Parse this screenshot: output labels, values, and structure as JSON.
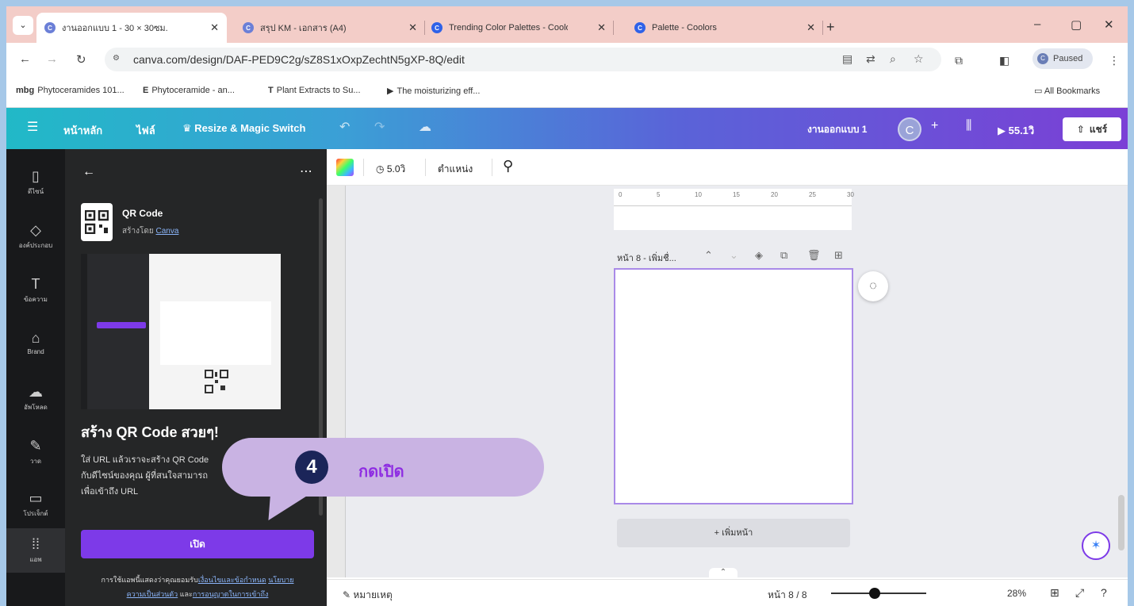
{
  "browser": {
    "tabs": [
      {
        "title": "งานออกแบบ 1 - 30 × 30ซม.",
        "fav_color": "#6b7fd7",
        "fav_glyph": "C",
        "active": true
      },
      {
        "title": "สรุป KM - เอกสาร (A4)",
        "fav_color": "#6b7fd7",
        "fav_glyph": "C",
        "active": false
      },
      {
        "title": "Trending Color Palettes - Coolo",
        "fav_color": "#2f62e8",
        "fav_glyph": "C",
        "active": false
      },
      {
        "title": "Palette - Coolors",
        "fav_color": "#2f62e8",
        "fav_glyph": "C",
        "active": false
      }
    ],
    "url": "canva.com/design/DAF-PED9C2g/sZ8S1xOxpZechtN5gXP-8Q/edit",
    "profile_status": "Paused",
    "profile_initial": "C",
    "bookmarks": [
      "Phytoceramides 101...",
      "Phytoceramide - an...",
      "Plant Extracts to Su...",
      "The moisturizing eff..."
    ],
    "bookmark_prefixes": [
      "mbg",
      "E",
      "T",
      "▶"
    ],
    "all_bookmarks": "All Bookmarks"
  },
  "canva_header": {
    "home": "หน้าหลัก",
    "file": "ไฟล์",
    "resize": "Resize & Magic Switch",
    "doc_title": "งานออกแบบ 1",
    "user_initial": "C",
    "timer": "55.1วิ",
    "share": "แชร์"
  },
  "rail": [
    {
      "label": "ดีไซน์",
      "icon": "▯"
    },
    {
      "label": "องค์ประกอบ",
      "icon": "◇"
    },
    {
      "label": "ข้อความ",
      "icon": "T"
    },
    {
      "label": "Brand",
      "icon": "⌂"
    },
    {
      "label": "อัพโหลด",
      "icon": "☁"
    },
    {
      "label": "วาด",
      "icon": "✎"
    },
    {
      "label": "โปรเจ็กต์",
      "icon": "▭"
    },
    {
      "label": "แอพ",
      "icon": "⁞⁞"
    }
  ],
  "panel": {
    "app_name": "QR Code",
    "by_prefix": "สร้างโดย",
    "by_link": "Canva",
    "headline": "สร้าง QR Code สวยๆ!",
    "desc_line1": "ใส่ URL แล้วเราจะสร้าง QR Code",
    "desc_line2": "กับดีไซน์ของคุณ ผู้ที่สนใจสามารถ",
    "desc_line3": "เพื่อเข้าถึง URL",
    "open_button": "เปิด",
    "terms_prefix": "การใช้แอพนี้แสดงว่าคุณยอมรับ",
    "terms_link1": "เงื่อนไขและข้อกำหนด",
    "terms_link2": "นโยบาย",
    "terms_link3": "ความเป็นส่วนตัว",
    "terms_and": "และ",
    "terms_link4": "การอนุญาตในการเข้าถึง"
  },
  "editor": {
    "duration": "5.0วิ",
    "position": "ตำแหน่ง",
    "ruler_ticks": [
      "0",
      "5",
      "10",
      "15",
      "20",
      "25",
      "30"
    ],
    "page_label": "หน้า 8 - เพิ่มชื่...",
    "add_page": "+ เพิ่มหน้า",
    "notes": "หมายเหตุ",
    "page_count": "หน้า 8 / 8",
    "zoom": "28%"
  },
  "callout": {
    "step": "4",
    "label": "กดเปิด",
    "color": "#c9b3e3"
  }
}
